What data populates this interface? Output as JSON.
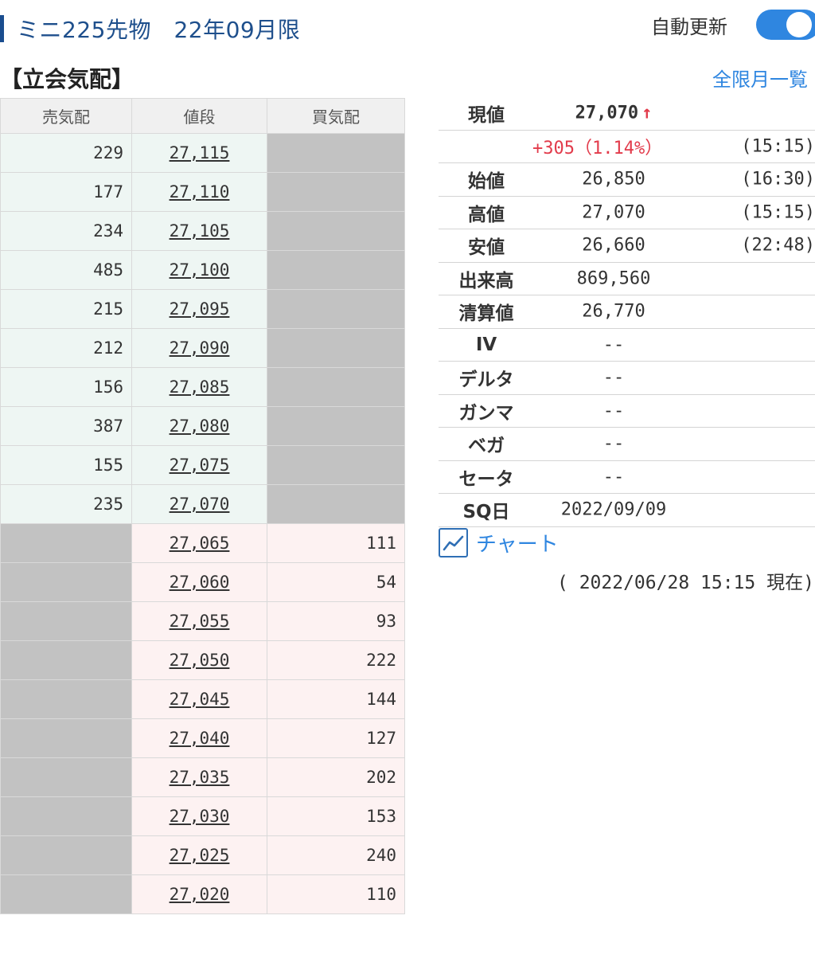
{
  "header": {
    "title": "ミニ225先物　22年09月限",
    "auto_update_label": "自動更新",
    "auto_update_on": true
  },
  "section": {
    "title": "【立会気配】",
    "all_months_link": "全限月一覧"
  },
  "colors": {
    "brand": "#1e4f8c",
    "accent": "#2f86e0",
    "up": "#e23b4b",
    "ask_bg": "#eef6f3",
    "bid_bg": "#fdf2f2",
    "empty_bg": "#c2c2c2"
  },
  "book": {
    "headers": [
      "売気配",
      "値段",
      "買気配"
    ],
    "asks": [
      {
        "sell": "229",
        "price": "27,115"
      },
      {
        "sell": "177",
        "price": "27,110"
      },
      {
        "sell": "234",
        "price": "27,105"
      },
      {
        "sell": "485",
        "price": "27,100"
      },
      {
        "sell": "215",
        "price": "27,095"
      },
      {
        "sell": "212",
        "price": "27,090"
      },
      {
        "sell": "156",
        "price": "27,085"
      },
      {
        "sell": "387",
        "price": "27,080"
      },
      {
        "sell": "155",
        "price": "27,075"
      },
      {
        "sell": "235",
        "price": "27,070"
      }
    ],
    "bids": [
      {
        "price": "27,065",
        "buy": "111"
      },
      {
        "price": "27,060",
        "buy": "54"
      },
      {
        "price": "27,055",
        "buy": "93"
      },
      {
        "price": "27,050",
        "buy": "222"
      },
      {
        "price": "27,045",
        "buy": "144"
      },
      {
        "price": "27,040",
        "buy": "127"
      },
      {
        "price": "27,035",
        "buy": "202"
      },
      {
        "price": "27,030",
        "buy": "153"
      },
      {
        "price": "27,025",
        "buy": "240"
      },
      {
        "price": "27,020",
        "buy": "110"
      }
    ]
  },
  "quote": {
    "current_label": "現値",
    "current_value": "27,070",
    "current_arrow": "↑",
    "change": "+305（1.14%）",
    "change_time": "(15:15)",
    "rows": [
      {
        "label": "始値",
        "value": "26,850",
        "time": "(16:30)"
      },
      {
        "label": "高値",
        "value": "27,070",
        "time": "(15:15)"
      },
      {
        "label": "安値",
        "value": "26,660",
        "time": "(22:48)"
      },
      {
        "label": "出来高",
        "value": "869,560",
        "time": ""
      },
      {
        "label": "清算値",
        "value": "26,770",
        "time": ""
      },
      {
        "label": "IV",
        "value": "--",
        "time": ""
      },
      {
        "label": "デルタ",
        "value": "--",
        "time": ""
      },
      {
        "label": "ガンマ",
        "value": "--",
        "time": ""
      },
      {
        "label": "ベガ",
        "value": "--",
        "time": ""
      },
      {
        "label": "セータ",
        "value": "--",
        "time": ""
      },
      {
        "label": "SQ日",
        "value": "2022/09/09",
        "time": ""
      }
    ],
    "chart_link": "チャート",
    "as_of": "( 2022/06/28 15:15 現在)"
  }
}
